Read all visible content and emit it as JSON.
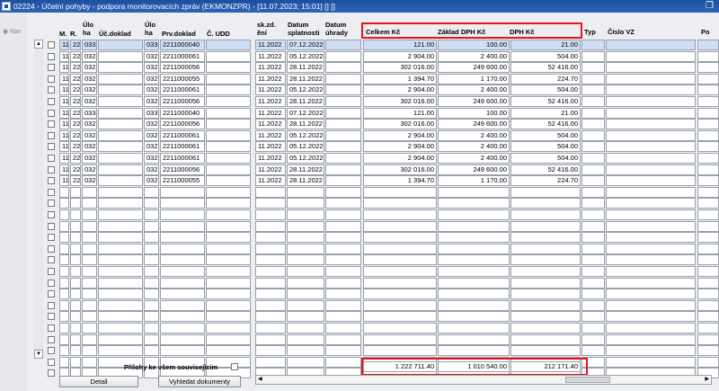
{
  "window": {
    "title": "02224 - Účetní pohyby - podpora monitorovacích zpráv (EKMONZPR) - [11.07.2023; 15:01] [] []",
    "restore_icon": "restore-icon"
  },
  "sidebar": {
    "nav_label": "Nav"
  },
  "columns": {
    "m": "M.",
    "r": "R.",
    "uloha1": "Úlo ha",
    "ucdoklad": "Úč.doklad",
    "uloha2": "Úlo ha",
    "prvdoklad": "Prv.doklad",
    "cudd": "Č. UDD",
    "skzd": "sk.zd. ění",
    "datum_splatnosti": "Datum splatnosti",
    "datum_uhrady": "Datum úhrady",
    "celkem": "Celkem Kč",
    "zaklad": "Základ DPH Kč",
    "dph": "DPH Kč",
    "typ": "Typ",
    "cislo_vz": "Číslo VZ",
    "po": "Po"
  },
  "rows": [
    {
      "m": "11",
      "r": "22",
      "uloha1": "033",
      "uloha2": "033",
      "prv": "2211000040",
      "sk": "11.2022",
      "splat": "07.12.2022",
      "celkem": "121.00",
      "zaklad": "100.00",
      "dph": "21.00"
    },
    {
      "m": "11",
      "r": "22",
      "uloha1": "032",
      "uloha2": "032",
      "prv": "2211000061",
      "sk": "11.2022",
      "splat": "05.12.2022",
      "celkem": "2 904.00",
      "zaklad": "2 400.00",
      "dph": "504.00"
    },
    {
      "m": "11",
      "r": "22",
      "uloha1": "032",
      "uloha2": "032",
      "prv": "2211000056",
      "sk": "11.2022",
      "splat": "28.11.2022",
      "celkem": "302 016.00",
      "zaklad": "249 600.00",
      "dph": "52 416.00"
    },
    {
      "m": "11",
      "r": "22",
      "uloha1": "032",
      "uloha2": "032",
      "prv": "2211000055",
      "sk": "11.2022",
      "splat": "28.11.2022",
      "celkem": "1 394.70",
      "zaklad": "1 170.00",
      "dph": "224.70"
    },
    {
      "m": "11",
      "r": "22",
      "uloha1": "032",
      "uloha2": "032",
      "prv": "2211000061",
      "sk": "11.2022",
      "splat": "05.12.2022",
      "celkem": "2 904.00",
      "zaklad": "2 400.00",
      "dph": "504.00"
    },
    {
      "m": "11",
      "r": "22",
      "uloha1": "032",
      "uloha2": "032",
      "prv": "2211000056",
      "sk": "11.2022",
      "splat": "28.11.2022",
      "celkem": "302 016.00",
      "zaklad": "249 600.00",
      "dph": "52 416.00"
    },
    {
      "m": "11",
      "r": "22",
      "uloha1": "033",
      "uloha2": "033",
      "prv": "2211000040",
      "sk": "11.2022",
      "splat": "07.12.2022",
      "celkem": "121.00",
      "zaklad": "100.00",
      "dph": "21.00"
    },
    {
      "m": "11",
      "r": "22",
      "uloha1": "032",
      "uloha2": "032",
      "prv": "2211000056",
      "sk": "11.2022",
      "splat": "28.11.2022",
      "celkem": "302 016.00",
      "zaklad": "249 600.00",
      "dph": "52 416.00"
    },
    {
      "m": "11",
      "r": "22",
      "uloha1": "032",
      "uloha2": "032",
      "prv": "2211000061",
      "sk": "11.2022",
      "splat": "05.12.2022",
      "celkem": "2 904.00",
      "zaklad": "2 400.00",
      "dph": "504.00"
    },
    {
      "m": "11",
      "r": "22",
      "uloha1": "032",
      "uloha2": "032",
      "prv": "2211000061",
      "sk": "11.2022",
      "splat": "05.12.2022",
      "celkem": "2 904.00",
      "zaklad": "2 400.00",
      "dph": "504.00"
    },
    {
      "m": "11",
      "r": "22",
      "uloha1": "032",
      "uloha2": "032",
      "prv": "2211000061",
      "sk": "11.2022",
      "splat": "05.12.2022",
      "celkem": "2 904.00",
      "zaklad": "2 400.00",
      "dph": "504.00"
    },
    {
      "m": "11",
      "r": "22",
      "uloha1": "032",
      "uloha2": "032",
      "prv": "2211000056",
      "sk": "11.2022",
      "splat": "28.11.2022",
      "celkem": "302 016.00",
      "zaklad": "249 600.00",
      "dph": "52 416.00"
    },
    {
      "m": "11",
      "r": "22",
      "uloha1": "032",
      "uloha2": "032",
      "prv": "2211000055",
      "sk": "11.2022",
      "splat": "28.11.2022",
      "celkem": "1 394.70",
      "zaklad": "1 170.00",
      "dph": "224.70"
    }
  ],
  "empty_row_count": 17,
  "totals": {
    "celkem": "1 222 711.40",
    "zaklad": "1 010 540.00",
    "dph": "212 171.40"
  },
  "footer": {
    "prilohy_label": "Přílohy ke všem souvisejícím",
    "detail_button": "Detail",
    "vyhledat_button": "Vyhledat dokumenty"
  },
  "colors": {
    "highlight": "#e01818",
    "selected_row": "#cfdff6",
    "titlebar": "#1c4f9e"
  }
}
